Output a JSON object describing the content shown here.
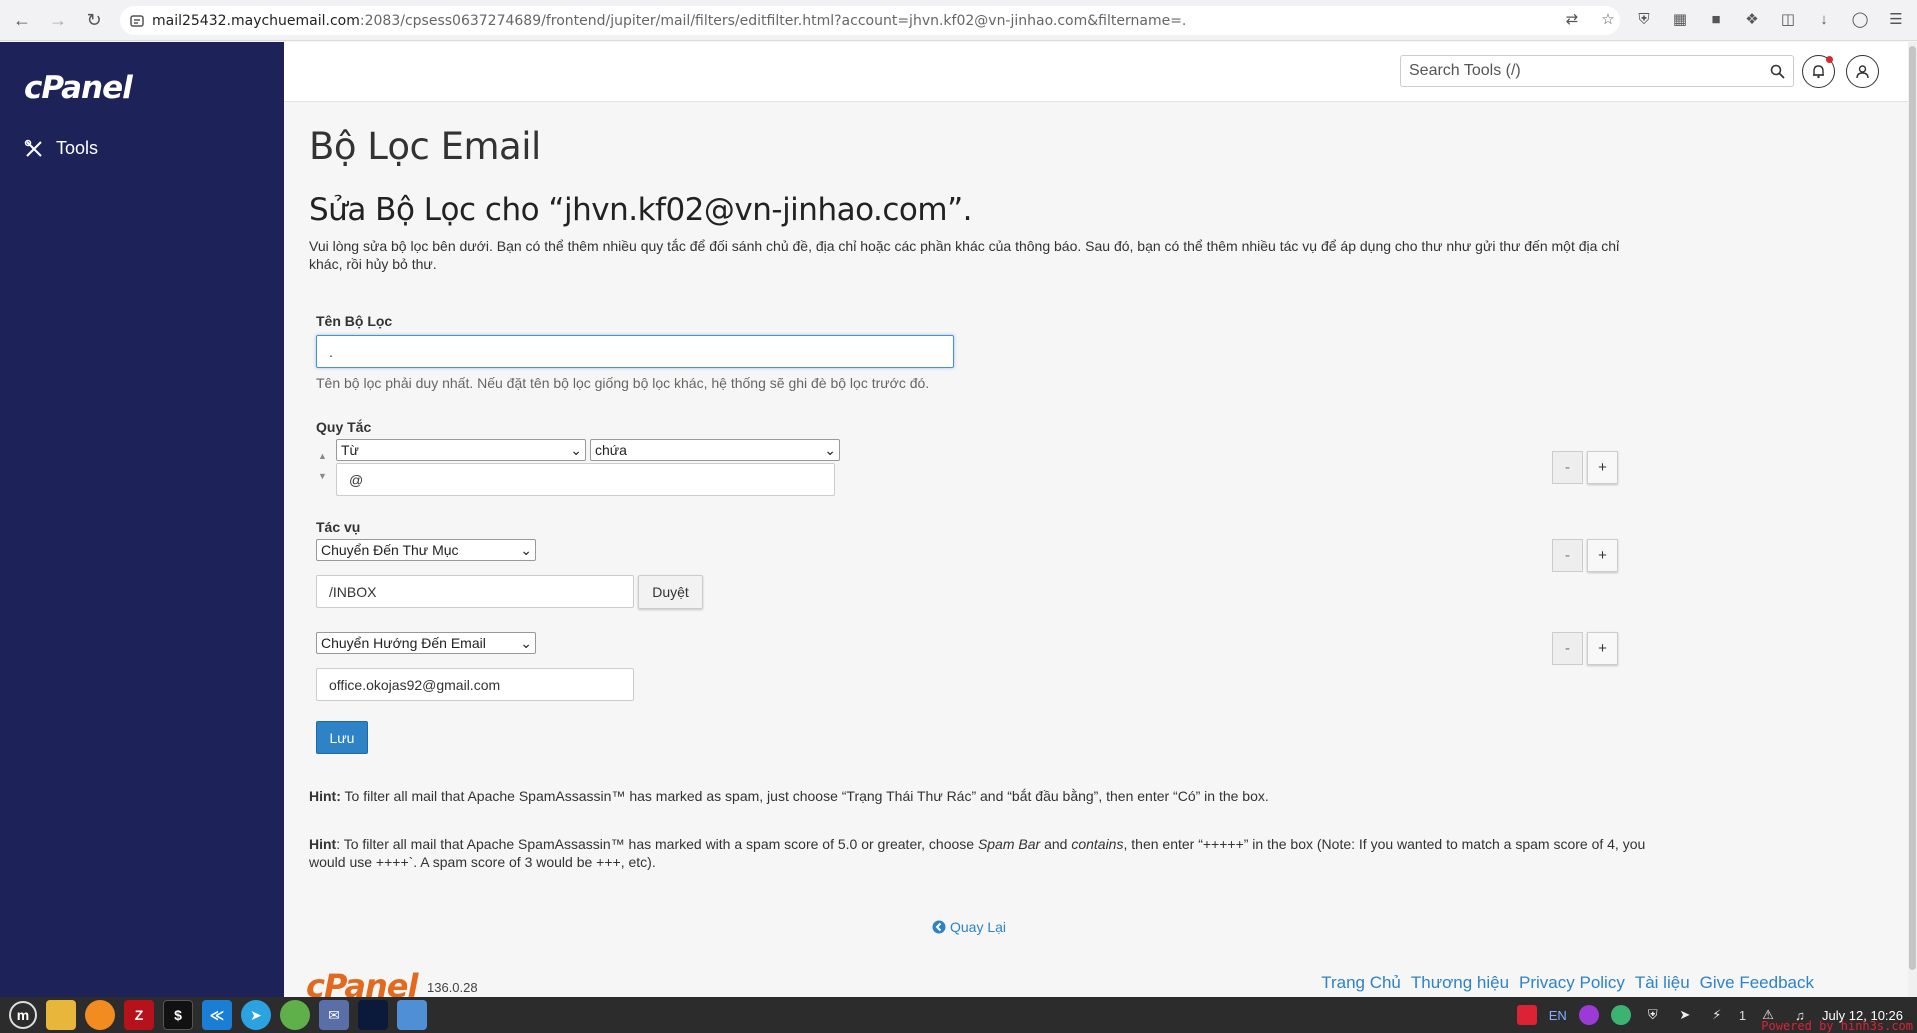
{
  "browser": {
    "url_host": "mail25432.maychuemail.com",
    "url_path": ":2083/cpsess0637274689/frontend/jupiter/mail/filters/editfilter.html?account=jhvn.kf02@vn-jinhao.com&filtername=."
  },
  "sidebar": {
    "logo": "cPanel",
    "items": [
      {
        "label": "Tools",
        "icon": "tools-icon"
      }
    ]
  },
  "header": {
    "search_placeholder": "Search Tools (/)"
  },
  "main": {
    "page_title": "Bộ Lọc Email",
    "sub_title": "Sửa Bộ Lọc cho “jhvn.kf02@vn-jinhao.com”.",
    "description": "Vui lòng sửa bộ lọc bên dưới. Bạn có thể thêm nhiều quy tắc để đối sánh chủ đề, địa chỉ hoặc các phần khác của thông báo. Sau đó, bạn có thể thêm nhiều tác vụ để áp dụng cho thư như gửi thư đến một địa chỉ khác, rồi hủy bỏ thư.",
    "filter_name_label": "Tên Bộ Lọc",
    "filter_name_value": ".",
    "filter_name_help": "Tên bộ lọc phải duy nhất. Nếu đặt tên bộ lọc giống bộ lọc khác, hệ thống sẽ ghi đè bộ lọc trước đó.",
    "rules_label": "Quy Tắc",
    "rule": {
      "part": "Từ",
      "match": "chứa",
      "value": "@"
    },
    "actions_label": "Tác vụ",
    "actions": [
      {
        "type": "Chuyển Đến Thư Mục",
        "value": "/INBOX",
        "browse_label": "Duyệt"
      },
      {
        "type": "Chuyển Hướng Đến Email",
        "value": "office.okojas92@gmail.com"
      }
    ],
    "minus_label": "-",
    "plus_label": "+",
    "save_label": "Lưu",
    "hint1_prefix": "Hint:",
    "hint1_text": " To filter all mail that Apache SpamAssassin™ has marked as spam, just choose “Trạng Thái Thư Rác” and “bắt đầu bằng”, then enter “Có” in the box.",
    "hint2_prefix": "Hint",
    "hint2_a": ": To filter all mail that Apache SpamAssassin™ has marked with a spam score of 5.0 or greater, choose ",
    "hint2_b": "Spam Bar",
    "hint2_c": " and ",
    "hint2_d": "contains",
    "hint2_e": ", then enter “+++++” in the box (Note: If you wanted to match a spam score of 4, you would use ++++`. A spam score of 3 would be +++, etc).",
    "back_label": "Quay Lại"
  },
  "footer": {
    "logo": "cPanel",
    "version": "136.0.28",
    "links": [
      "Trang Chủ",
      "Thương hiệu",
      "Privacy Policy",
      "Tài liệu",
      "Give Feedback"
    ]
  },
  "taskbar": {
    "lang": "EN",
    "badge": "1",
    "datetime": "July 12, 10:26",
    "powered": "Powered by hinh3s.com"
  }
}
